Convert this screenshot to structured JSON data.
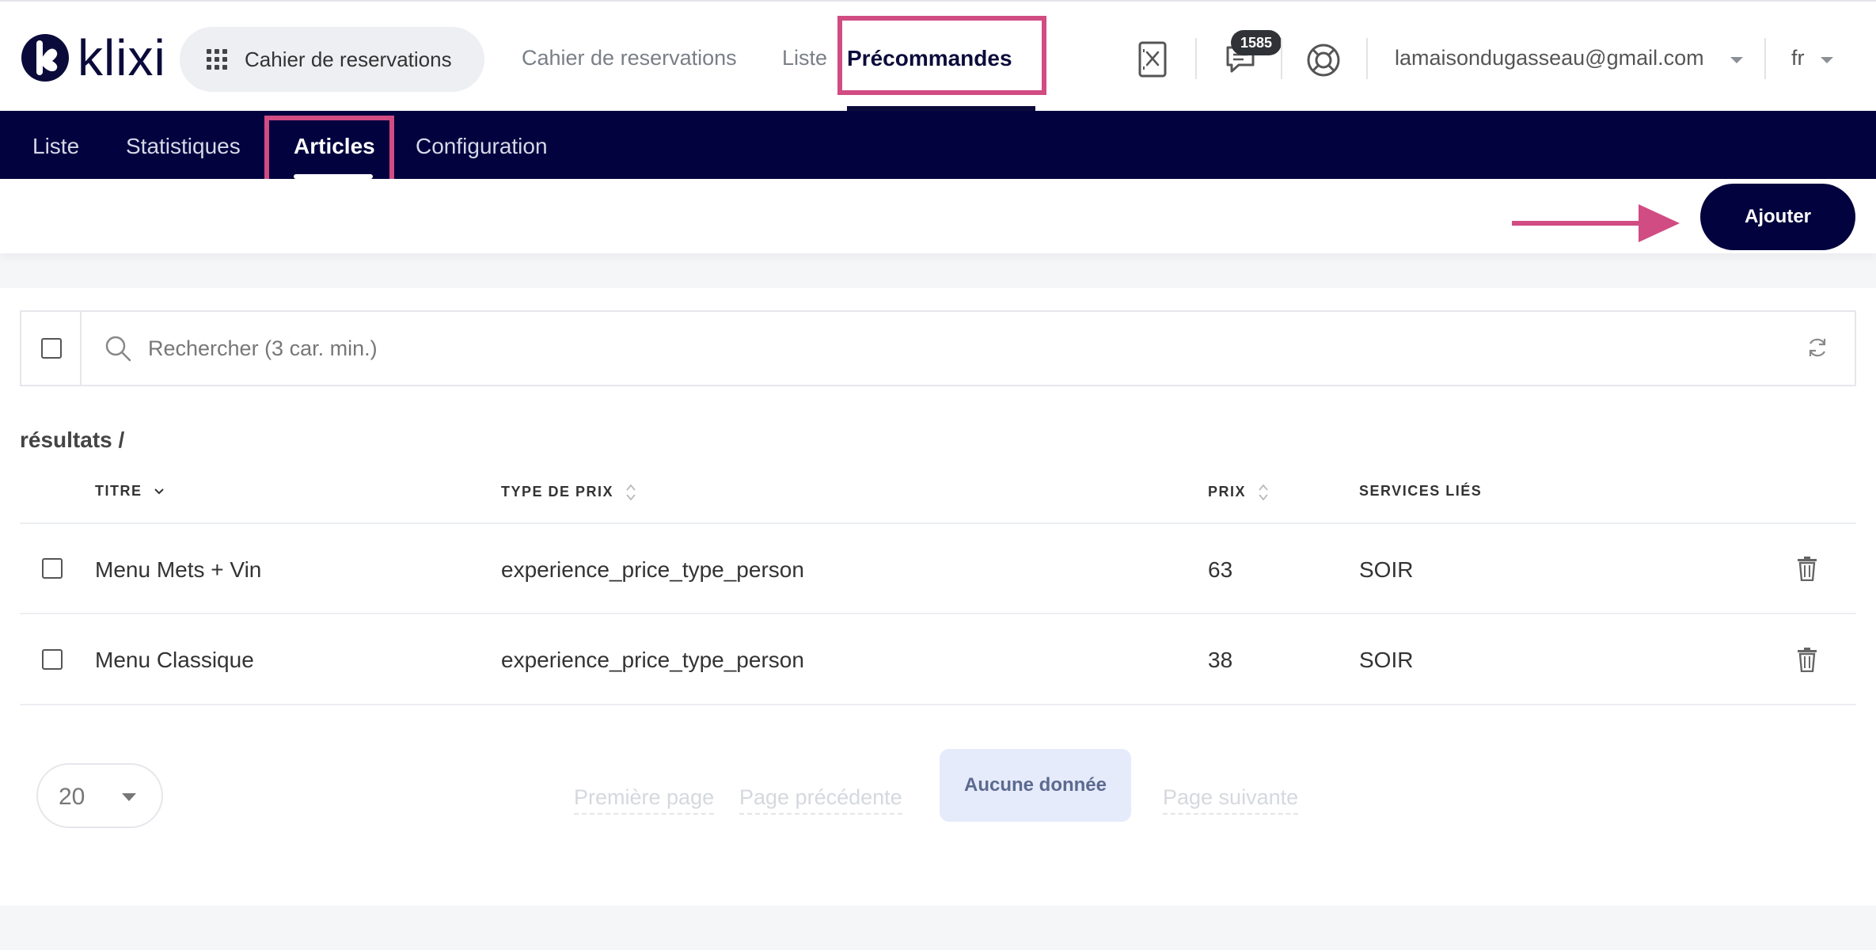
{
  "brand": {
    "name": "klixi"
  },
  "header": {
    "app_switcher_label": "Cahier de reservations",
    "nav": [
      {
        "label": "Cahier de reservations"
      },
      {
        "label": "Liste"
      },
      {
        "label": "Précommandes"
      }
    ],
    "messages_badge": "1585",
    "user_email": "lamaisondugasseau@gmail.com",
    "language": "fr"
  },
  "subnav": {
    "items": [
      {
        "label": "Liste"
      },
      {
        "label": "Statistiques"
      },
      {
        "label": "Articles"
      },
      {
        "label": "Configuration"
      }
    ],
    "active": "Articles"
  },
  "actions": {
    "add_label": "Ajouter"
  },
  "search": {
    "placeholder": "Rechercher (3 car. min.)",
    "value": ""
  },
  "results_label": "résultats /",
  "table": {
    "columns": [
      {
        "label": "TITRE"
      },
      {
        "label": "TYPE DE PRIX"
      },
      {
        "label": "PRIX"
      },
      {
        "label": "SERVICES LIÉS"
      }
    ],
    "rows": [
      {
        "title": "Menu Mets + Vin",
        "price_type": "experience_price_type_person",
        "price": "63",
        "services": "SOIR"
      },
      {
        "title": "Menu Classique",
        "price_type": "experience_price_type_person",
        "price": "38",
        "services": "SOIR"
      }
    ]
  },
  "pagination": {
    "page_size": "20",
    "first": "Première page",
    "previous": "Page précédente",
    "current": "Aucune donnée",
    "next": "Page suivante"
  },
  "colors": {
    "navy": "#02023f",
    "highlight": "#d14c82",
    "background": "#f5f6f8"
  }
}
